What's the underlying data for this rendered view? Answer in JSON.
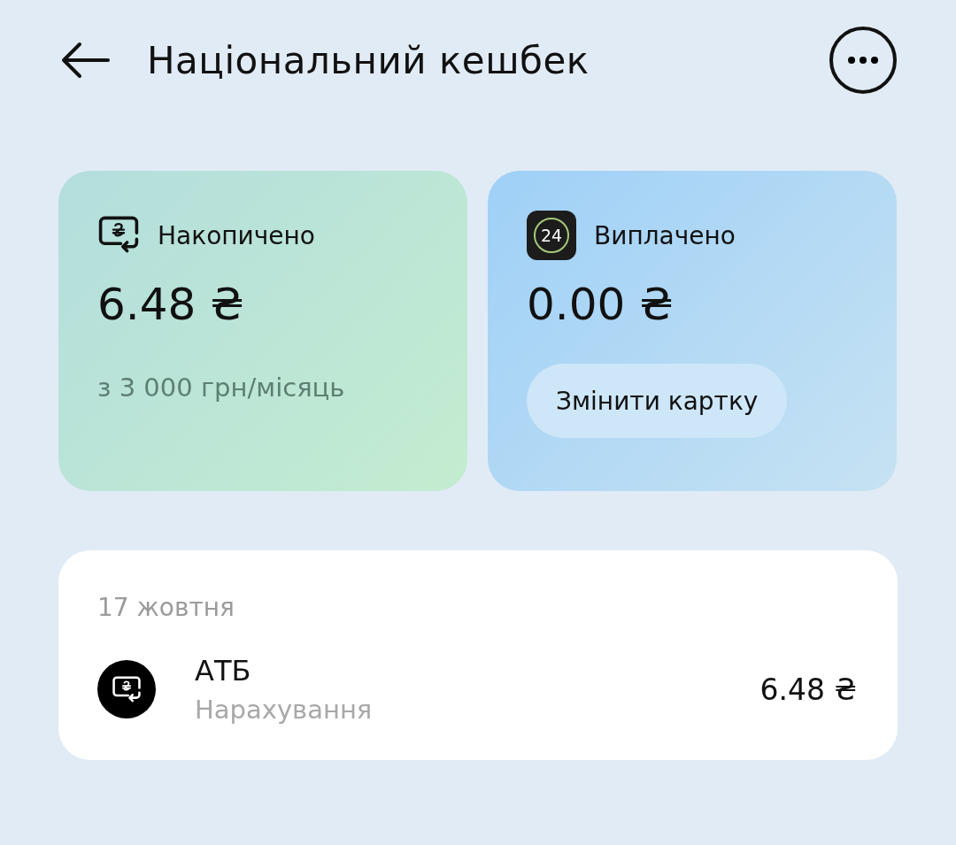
{
  "header": {
    "title": "Національний кешбек"
  },
  "cards": [
    {
      "kind": "accrued",
      "label": "Накопичено",
      "amount": "6.48 ₴",
      "note": "з 3 000 грн/місяць"
    },
    {
      "kind": "paid",
      "label": "Виплачено",
      "badge": "24",
      "amount": "0.00 ₴",
      "button": "Змінити картку"
    }
  ],
  "history": {
    "date": "17 жовтня",
    "items": [
      {
        "merchant": "АТБ",
        "type": "Нарахування",
        "amount": "6.48 ₴"
      }
    ]
  }
}
